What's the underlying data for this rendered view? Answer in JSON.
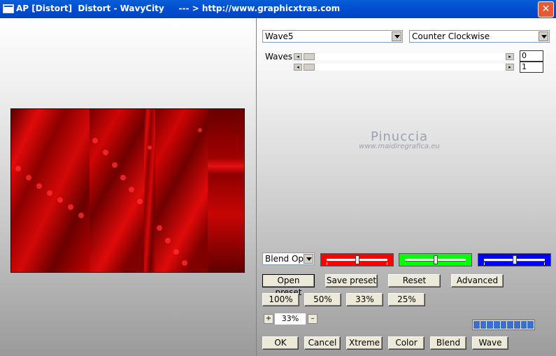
{
  "window": {
    "title": "AP [Distort]  Distort - WavyCity     --- > http://www.graphicxtras.com",
    "close_glyph": "✕"
  },
  "controls": {
    "effect_select": "Wave5",
    "direction_select": "Counter Clockwise",
    "waves_label": "Waves",
    "slider1_value": "0",
    "slider2_value": "1",
    "blend_select": "Blend Opti"
  },
  "watermark": {
    "line1": "Pinuccia",
    "line2": "www.maidiregrafica.eu"
  },
  "color_sliders": {
    "red": {
      "color": "#ff0000",
      "level": 0.5
    },
    "green": {
      "color": "#00ff00",
      "level": 0.5
    },
    "blue": {
      "color": "#0000ff",
      "level": 0.5
    }
  },
  "buttons": {
    "open_preset": "Open preset",
    "save_preset": "Save preset",
    "reset": "Reset",
    "advanced": "Advanced",
    "zoom_100": "100%",
    "zoom_50": "50%",
    "zoom_33": "33%",
    "zoom_25": "25%",
    "plus": "+",
    "minus": "–",
    "ok": "OK",
    "cancel": "Cancel",
    "xtreme": "Xtreme",
    "color": "Color",
    "blend": "Blend",
    "wave": "Wave"
  },
  "zoom": {
    "value": "33%"
  },
  "progress": {
    "segments": 9,
    "filled": 9
  }
}
